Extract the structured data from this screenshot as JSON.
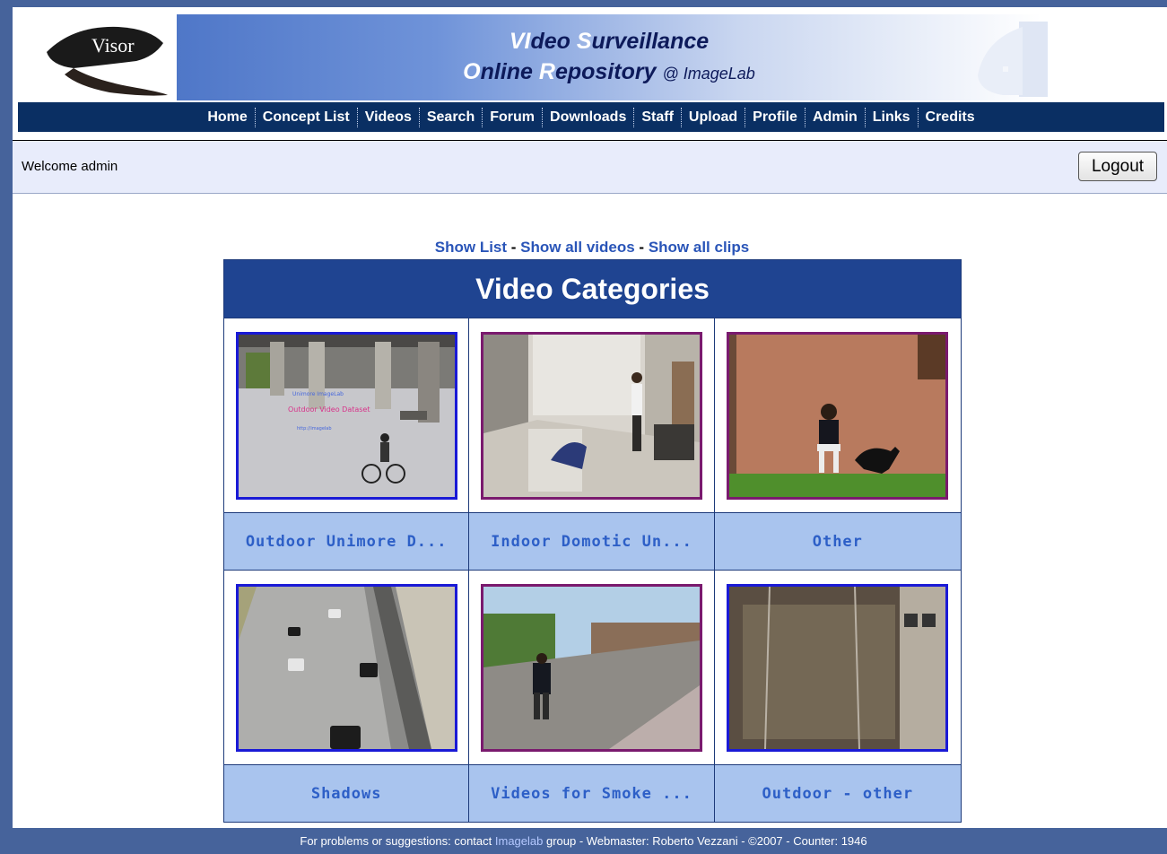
{
  "header": {
    "logo_text": "Visor",
    "title_line1": {
      "part1": "VI",
      "part2": "deo ",
      "part3": "S",
      "part4": "urveillance"
    },
    "title_line2": {
      "part1": "O",
      "part2": "nline ",
      "part3": "R",
      "part4": "epository",
      "suffix": "@ ImageLab"
    }
  },
  "nav": {
    "items": [
      "Home",
      "Concept List",
      "Videos",
      "Search",
      "Forum",
      "Downloads",
      "Staff",
      "Upload",
      "Profile",
      "Admin",
      "Links",
      "Credits"
    ]
  },
  "welcome": {
    "text": "Welcome admin",
    "logout_label": "Logout"
  },
  "show_links": {
    "list": "Show List",
    "sep1": " - ",
    "all_videos": "Show all videos",
    "sep2": " - ",
    "all_clips": "Show all clips"
  },
  "categories": {
    "title": "Video Categories",
    "items": [
      {
        "label": "Outdoor Unimore D...",
        "border": "blue"
      },
      {
        "label": "Indoor Domotic Un...",
        "border": "purple"
      },
      {
        "label": "Other",
        "border": "purple"
      },
      {
        "label": "Shadows",
        "border": "blue"
      },
      {
        "label": "Videos for Smoke ...",
        "border": "purple"
      },
      {
        "label": "Outdoor - other",
        "border": "blue"
      }
    ]
  },
  "footer": {
    "prefix": "For problems or suggestions: contact ",
    "link": "Imagelab",
    "suffix": " group - Webmaster: Roberto Vezzani - ©2007 - Counter: 1946"
  },
  "colors": {
    "frame": "#46639b",
    "nav_bg": "#0a2f63",
    "table_header": "#1f4491",
    "label_bg": "#a9c4ee",
    "label_text": "#2d5fc7"
  }
}
